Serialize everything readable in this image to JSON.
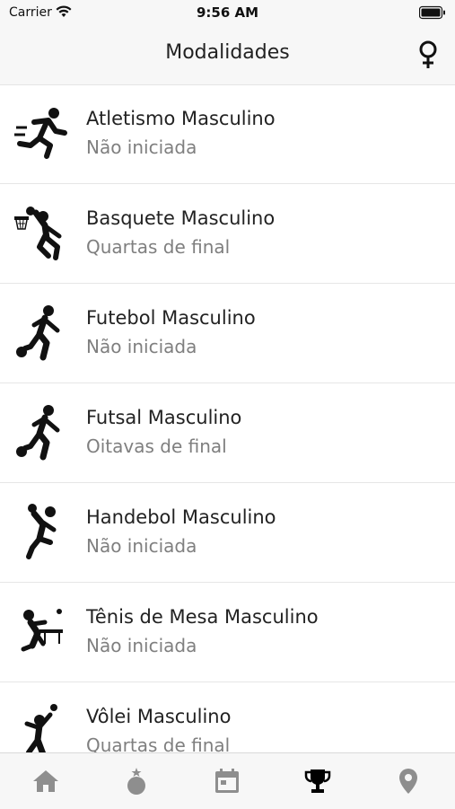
{
  "status_bar": {
    "carrier": "Carrier",
    "time": "9:56 AM"
  },
  "header": {
    "title": "Modalidades",
    "gender_icon": "female-symbol-icon"
  },
  "sports": [
    {
      "title": "Atletismo Masculino",
      "status": "Não iniciada",
      "icon": "running-icon"
    },
    {
      "title": "Basquete Masculino",
      "status": "Quartas de final",
      "icon": "basketball-player-icon"
    },
    {
      "title": "Futebol Masculino",
      "status": "Não iniciada",
      "icon": "soccer-player-icon"
    },
    {
      "title": "Futsal Masculino",
      "status": "Oitavas de final",
      "icon": "futsal-player-icon"
    },
    {
      "title": "Handebol Masculino",
      "status": "Não iniciada",
      "icon": "handball-player-icon"
    },
    {
      "title": "Tênis de Mesa Masculino",
      "status": "Não iniciada",
      "icon": "table-tennis-player-icon"
    },
    {
      "title": "Vôlei Masculino",
      "status": "Quartas de final",
      "icon": "volleyball-player-icon"
    }
  ],
  "tabs": [
    {
      "icon": "home-icon",
      "active": false
    },
    {
      "icon": "medal-icon",
      "active": false
    },
    {
      "icon": "calendar-icon",
      "active": false
    },
    {
      "icon": "trophy-icon",
      "active": true
    },
    {
      "icon": "location-pin-icon",
      "active": false
    }
  ],
  "colors": {
    "active_tab": "#000000",
    "inactive_tab": "#8e8e8e",
    "subtitle": "#7f7f7f"
  }
}
